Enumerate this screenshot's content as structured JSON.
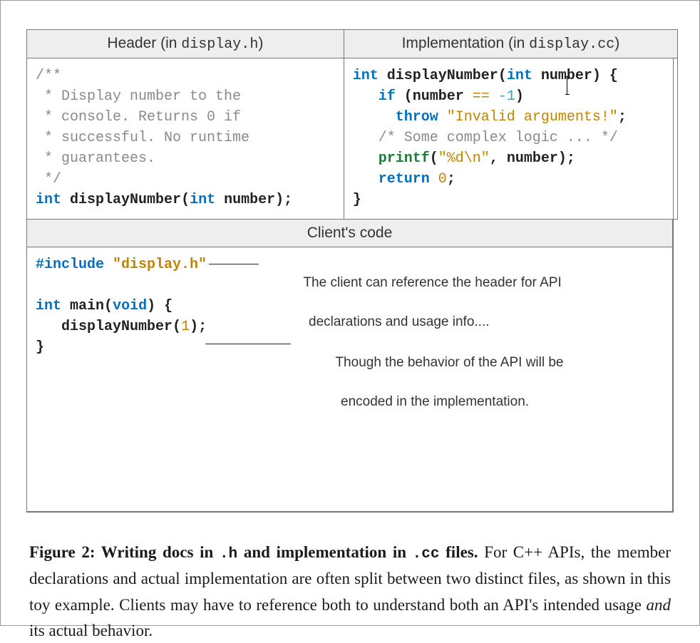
{
  "panels": {
    "header": {
      "title_prefix": "Header (in ",
      "title_file": "display.h",
      "title_suffix": ")",
      "code": {
        "comment_open": "/**",
        "comment_l1": " * Display number to the",
        "comment_l2": " * console. Returns 0 if",
        "comment_l3": " * successful. No runtime",
        "comment_l4": " * guarantees.",
        "comment_close": " */",
        "sig_ret": "int",
        "sig_name": "displayNumber",
        "sig_ptype": "int",
        "sig_pname": "number",
        "sig_tail": ");"
      }
    },
    "impl": {
      "title_prefix": "Implementation (in ",
      "title_file": "display.cc",
      "title_suffix": ")",
      "code": {
        "sig_ret": "int",
        "sig_name": "displayNumber",
        "sig_ptype": "int",
        "sig_pname_a": "num",
        "sig_pname_b": "ber",
        "sig_open": ") {",
        "if_kw": "if",
        "if_open": " (",
        "if_var": "number",
        "if_eq": " == ",
        "if_val": "-1",
        "if_close": ")",
        "throw_kw": "throw",
        "throw_str": "\"Invalid arguments!\"",
        "throw_tail": ";",
        "logic_comment": "/* Some complex logic ... */",
        "printf_name": "printf",
        "printf_open": "(",
        "printf_fmt": "\"%d\\n\"",
        "printf_comma": ", ",
        "printf_arg": "number",
        "printf_close": ");",
        "return_kw": "return",
        "return_val": "0",
        "return_tail": ";",
        "brace_close": "}"
      }
    },
    "client": {
      "title": "Client's code",
      "code": {
        "include_kw": "#include",
        "include_file": "\"display.h\"",
        "main_ret": "int",
        "main_name": "main",
        "main_ptype": "void",
        "main_open": ") {",
        "call_name": "displayNumber",
        "call_arg": "1",
        "call_tail": ");",
        "brace_close": "}"
      },
      "note1_a": "The client can reference the header for API",
      "note1_b": "declarations and usage info....",
      "note2_a": "Though the behavior of the API will be",
      "note2_b": "encoded in the implementation."
    }
  },
  "caption": {
    "lead_a": "Figure 2: Writing docs in ",
    "lead_file1": ".h",
    "lead_mid": " and implementation in ",
    "lead_file2": ".cc",
    "lead_b": " files.",
    "body_a": " For C++ APIs, the member declarations and actual implementation are often split between two distinct files, as shown in this toy example. Clients may have to reference both to understand both an API's intended usage ",
    "body_em": "and",
    "body_b": " its actual behavior."
  }
}
